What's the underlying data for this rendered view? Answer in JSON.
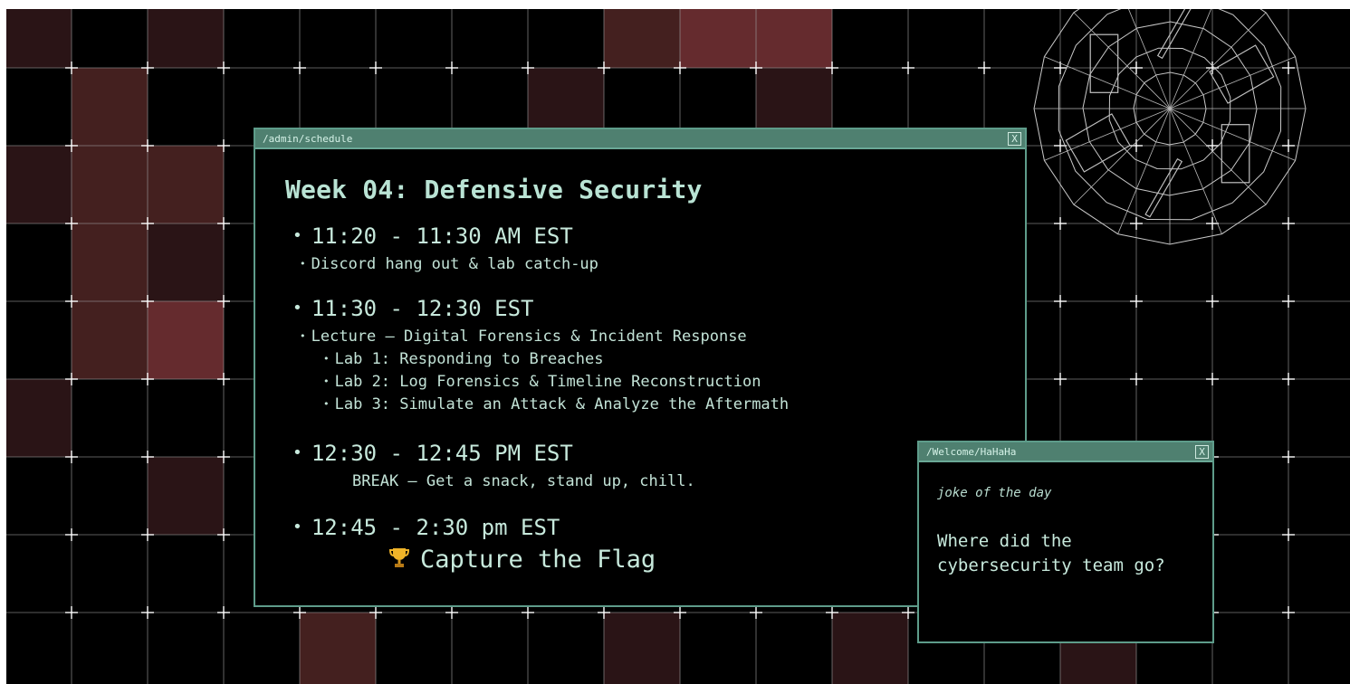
{
  "colors": {
    "background": "#000000",
    "grid_line": "#9a9a9a",
    "tile_dark": "#2a1416",
    "tile_mid": "#44201f",
    "tile_bright": "#652b2e",
    "window_border": "#5e9c8a",
    "window_titlebar": "#4f8070",
    "text": "#c7e9dc"
  },
  "schedule_window": {
    "path": "/admin/schedule",
    "close_label": "X",
    "title": "Week 04: Defensive Security",
    "blocks": [
      {
        "time": "11:20 - 11:30 AM EST",
        "items": [
          "Discord hang out & lab catch-up"
        ]
      },
      {
        "time": "11:30 - 12:30 EST",
        "items": [
          "Lecture – Digital Forensics & Incident Response"
        ],
        "labs": [
          "Lab 1: Responding to Breaches",
          "Lab 2: Log Forensics & Timeline Reconstruction",
          "Lab 3: Simulate an Attack & Analyze the Aftermath"
        ]
      },
      {
        "time": "12:30 - 12:45 PM EST",
        "note": "BREAK – Get a snack, stand up, chill."
      },
      {
        "time": "12:45 - 2:30 pm EST",
        "highlight_icon": "trophy-icon",
        "highlight": "Capture the Flag"
      }
    ]
  },
  "joke_window": {
    "path": "/Welcome/HaHaHa",
    "close_label": "X",
    "label": "joke of the day",
    "question": "Where did the cybersecurity team go?"
  },
  "decorations": {
    "background_grid": "grid-with-red-tiles",
    "top_right": "wireframe-polygon-icon"
  }
}
